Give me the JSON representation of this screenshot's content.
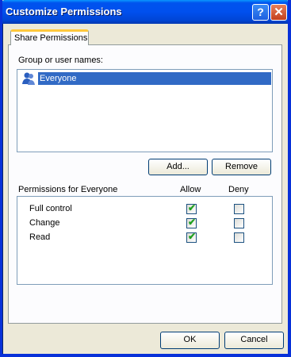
{
  "window": {
    "title": "Customize Permissions",
    "help_glyph": "?",
    "close_glyph": "✕"
  },
  "tab": {
    "label": "Share Permissions"
  },
  "group_label": "Group or user names:",
  "users": [
    {
      "name": "Everyone",
      "icon": "user-group-icon"
    }
  ],
  "buttons": {
    "add": "Add...",
    "remove": "Remove",
    "ok": "OK",
    "cancel": "Cancel"
  },
  "permissions": {
    "header": "Permissions for Everyone",
    "allow_label": "Allow",
    "deny_label": "Deny",
    "rows": [
      {
        "name": "Full control",
        "allow": true,
        "deny": false
      },
      {
        "name": "Change",
        "allow": true,
        "deny": false
      },
      {
        "name": "Read",
        "allow": true,
        "deny": false
      }
    ]
  },
  "colors": {
    "title_bar": "#0054e3",
    "selection": "#316ac5",
    "check": "#21a121"
  }
}
